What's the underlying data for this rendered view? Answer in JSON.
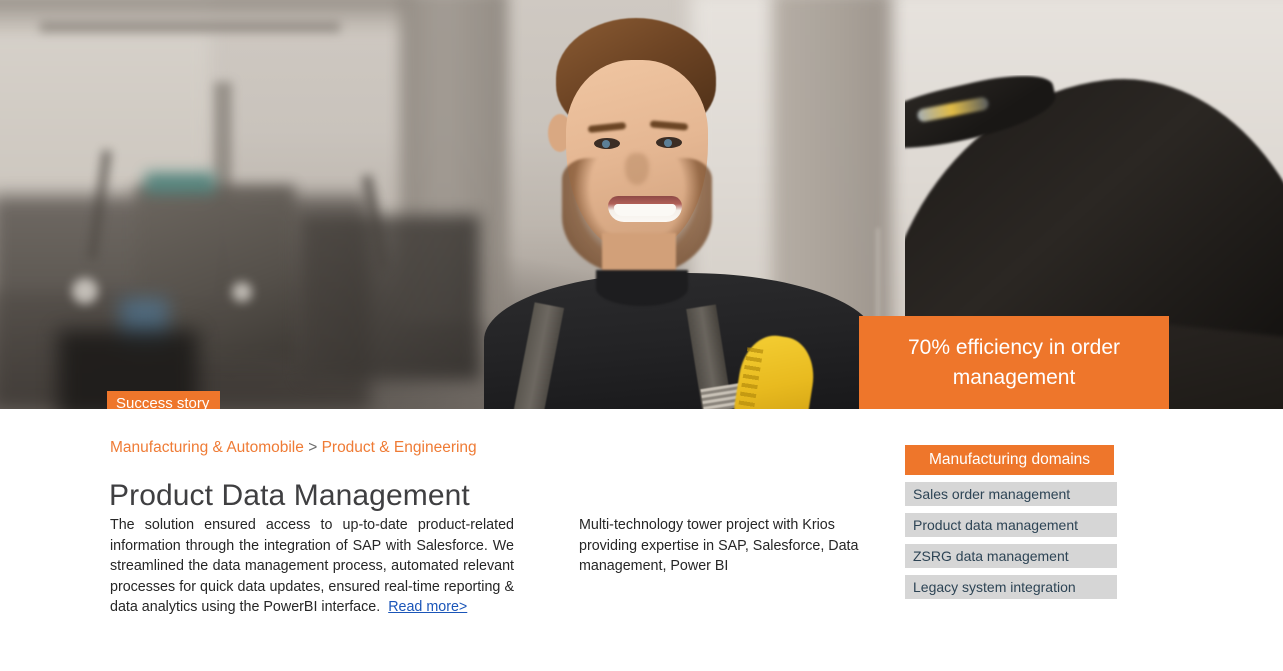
{
  "hero": {
    "stat_callout": "70% efficiency in order management",
    "badge_label": "Success story",
    "photo_alt": "smiling-workshop-technician-photo",
    "accent_color": "#ee762b"
  },
  "breadcrumb": {
    "parent": "Manufacturing & Automobile",
    "separator": ">",
    "child": "Product & Engineering",
    "color": "#ef7b35"
  },
  "page_title": "Product Data Management",
  "columns": {
    "summary": "The solution ensured access to up-to-date product-related information through the integration of SAP with Salesforce. We streamlined the data management process, automated relevant processes for quick data updates, ensured real-time reporting & data analytics using the PowerBI interface.",
    "read_more_label": "Read more>",
    "read_more_color": "#1a55b8",
    "scope": "Multi-technology tower project with Krios providing expertise in SAP, Salesforce, Data management, Power BI"
  },
  "sidebar": {
    "header": "Manufacturing domains",
    "header_bg": "#ee762b",
    "item_bg": "#d6d6d6",
    "item_color": "#2d4455",
    "items": [
      {
        "label": "Sales order management"
      },
      {
        "label": "Product data management"
      },
      {
        "label": "ZSRG data management"
      },
      {
        "label": "Legacy system integration"
      }
    ]
  }
}
